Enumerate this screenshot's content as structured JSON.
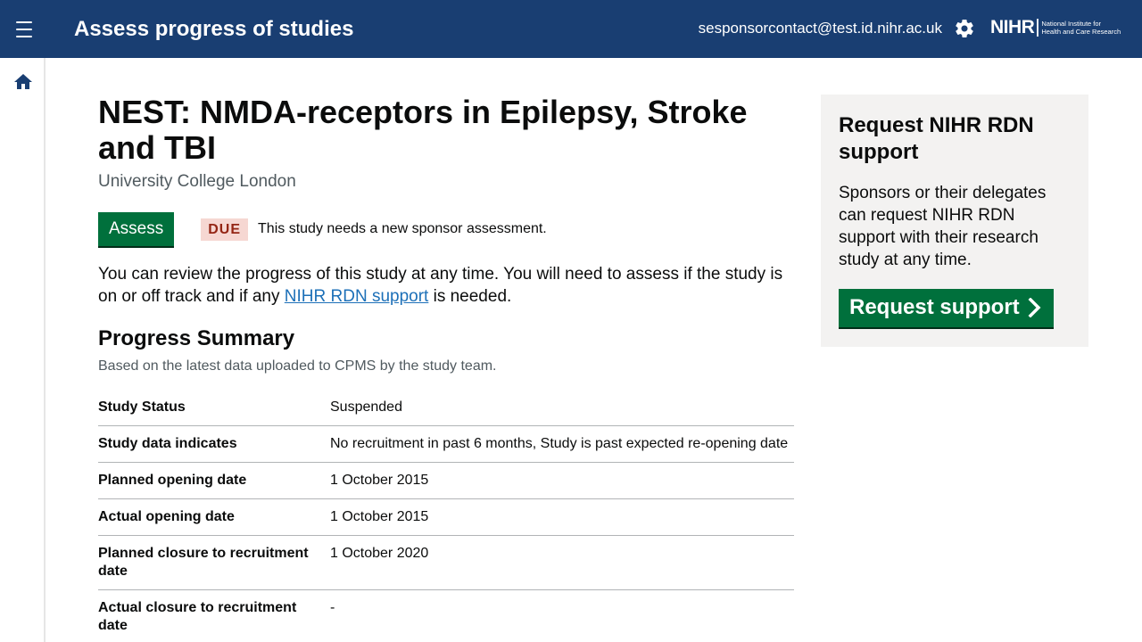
{
  "header": {
    "title": "Assess progress of studies",
    "user_email": "sesponsorcontact@test.id.nihr.ac.uk",
    "logo_word": "NIHR",
    "logo_sub_line1": "National Institute for",
    "logo_sub_line2": "Health and Care Research",
    "icons": [
      "menu-icon",
      "gear-icon",
      "home-icon"
    ]
  },
  "study": {
    "title": "NEST: NMDA-receptors in Epilepsy, Stroke and TBI",
    "organisation": "University College London",
    "assess_label": "Assess",
    "status_tag": "DUE",
    "status_text": "This study needs a new sponsor assessment.",
    "intro_before": "You can review the progress of this study at any time. You will need to assess if the study is on or off track and if any ",
    "intro_link": "NIHR RDN support",
    "intro_after": " is needed."
  },
  "summary": {
    "heading": "Progress Summary",
    "hint": "Based on the latest data uploaded to CPMS by the study team.",
    "rows": [
      {
        "key": "Study Status",
        "value": "Suspended"
      },
      {
        "key": "Study data indicates",
        "value": "No recruitment in past 6 months, Study is past expected re-opening date"
      },
      {
        "key": "Planned opening date",
        "value": "1 October 2015"
      },
      {
        "key": "Actual opening date",
        "value": "1 October 2015"
      },
      {
        "key": "Planned closure to recruitment date",
        "value": "1 October 2020"
      },
      {
        "key": "Actual closure to recruitment date",
        "value": "-"
      }
    ]
  },
  "support_panel": {
    "heading": "Request NIHR RDN support",
    "body": "Sponsors or their delegates can request NIHR RDN support with their research study at any time.",
    "button_label": "Request support"
  },
  "colors": {
    "header_bg": "#193e72",
    "primary_green": "#00703c",
    "link_blue": "#1d70b8",
    "due_tag_bg": "#f6d7d2",
    "due_tag_text": "#942514",
    "panel_bg": "#f3f2f1"
  }
}
